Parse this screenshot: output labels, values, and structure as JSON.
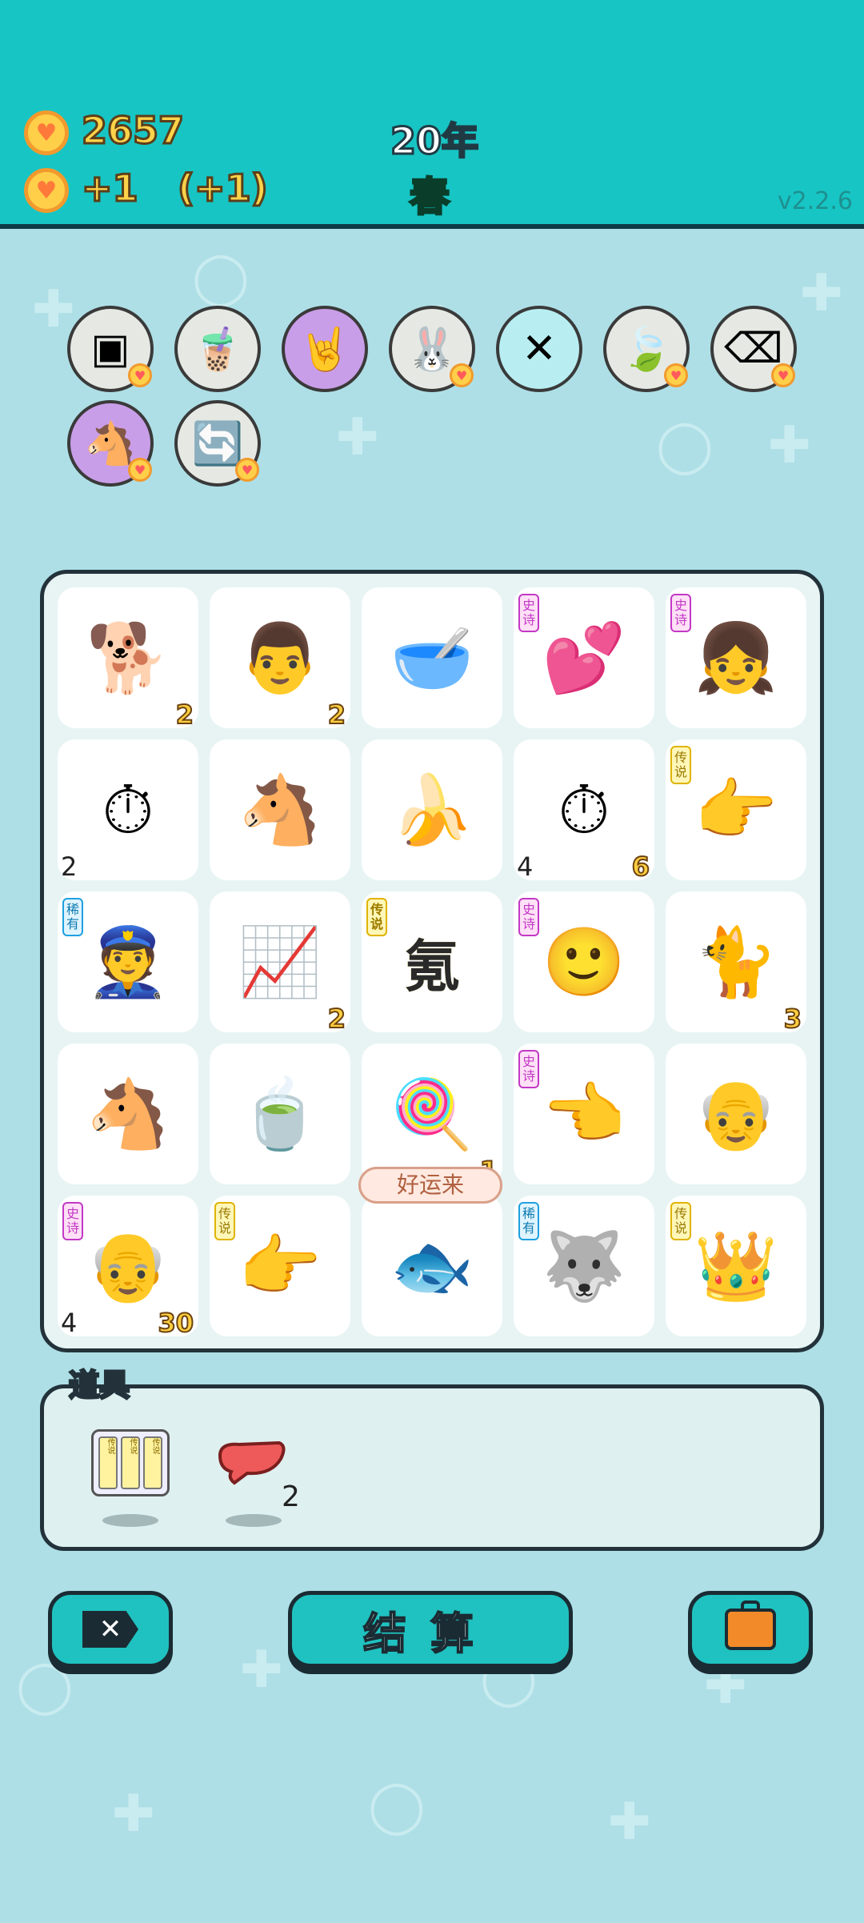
{
  "hud": {
    "coins": "2657",
    "income": "+1",
    "bonus": "(+1)",
    "year": "20年",
    "season": "春",
    "version": "v2.2.6"
  },
  "upgrades": [
    {
      "icon": "sugar-cubes-icon",
      "glyph": "▣",
      "bg": "#e6e9e3",
      "heart": true
    },
    {
      "icon": "bubble-tea-icon",
      "glyph": "🧋",
      "bg": "#e6e9e3",
      "heart": false
    },
    {
      "icon": "rock-hand-icon",
      "glyph": "🤘",
      "bg": "#c99ee8",
      "heart": false
    },
    {
      "icon": "bunny-icon",
      "glyph": "🐰",
      "bg": "#e6e9e3",
      "heart": true
    },
    {
      "icon": "chopsticks-icon",
      "glyph": "✕",
      "bg": "#b8eef2",
      "heart": false
    },
    {
      "icon": "leaf-icon",
      "glyph": "🍃",
      "bg": "#e6e9e3",
      "heart": true
    },
    {
      "icon": "delete-tag-icon",
      "glyph": "⌫",
      "bg": "#e6e9e3",
      "heart": true
    },
    {
      "icon": "twin-horses-icon",
      "glyph": "🐴",
      "bg": "#c99ee8",
      "heart": true
    },
    {
      "icon": "refresh-icon",
      "glyph": "🔄",
      "bg": "#e6e9e3",
      "heart": true
    }
  ],
  "board": [
    {
      "icon": "dog-icon",
      "glyph": "🐕",
      "badge": "",
      "count_r": "2",
      "count_l": ""
    },
    {
      "icon": "man-face-icon",
      "glyph": "👨",
      "badge": "",
      "count_r": "2",
      "count_l": ""
    },
    {
      "icon": "bowl-icon",
      "glyph": "🥣",
      "badge": "",
      "count_r": "",
      "count_l": ""
    },
    {
      "icon": "girl-hearts-icon",
      "glyph": "💕",
      "badge": "史诗",
      "badge_type": "epic",
      "count_r": "",
      "count_l": ""
    },
    {
      "icon": "girl-face-icon",
      "glyph": "👧",
      "badge": "史诗",
      "badge_type": "epic",
      "count_r": "",
      "count_l": ""
    },
    {
      "icon": "stopwatch-card-icon",
      "glyph": "⏱",
      "badge": "",
      "count_r": "",
      "count_l": "2"
    },
    {
      "icon": "horse-icon",
      "glyph": "🐴",
      "badge": "",
      "count_r": "",
      "count_l": ""
    },
    {
      "icon": "banana-icon",
      "glyph": "🍌",
      "badge": "",
      "count_r": "",
      "count_l": ""
    },
    {
      "icon": "stopwatch-card-icon",
      "glyph": "⏱",
      "badge": "",
      "count_r": "6",
      "count_l": "4"
    },
    {
      "icon": "yellow-hand-icon",
      "glyph": "👉",
      "badge": "传说",
      "badge_type": "legend",
      "count_r": "",
      "count_l": ""
    },
    {
      "icon": "police-icon",
      "glyph": "👮",
      "badge": "稀有",
      "badge_type": "rare",
      "count_r": "",
      "count_l": ""
    },
    {
      "icon": "chart-up-icon",
      "glyph": "📈",
      "badge": "",
      "count_r": "2",
      "count_l": ""
    },
    {
      "icon": "krypton-glyph-icon",
      "glyph": "氪",
      "badge": "传说",
      "badge_type": "legend",
      "count_r": "",
      "count_l": ""
    },
    {
      "icon": "yellow-face-icon",
      "glyph": "🙂",
      "badge": "史诗",
      "badge_type": "epic",
      "count_r": "",
      "count_l": ""
    },
    {
      "icon": "cat-icon",
      "glyph": "🐈",
      "badge": "",
      "count_r": "3",
      "count_l": ""
    },
    {
      "icon": "horse-icon",
      "glyph": "🐴",
      "badge": "",
      "count_r": "",
      "count_l": ""
    },
    {
      "icon": "tea-bag-icon",
      "glyph": "🍵",
      "badge": "",
      "count_r": "",
      "count_l": ""
    },
    {
      "icon": "lucky-lollipop-icon",
      "glyph": "🍭",
      "badge": "",
      "count_r": "1",
      "count_l": ""
    },
    {
      "icon": "gray-hand-icon",
      "glyph": "👈",
      "badge": "史诗",
      "badge_type": "epic",
      "count_r": "",
      "count_l": ""
    },
    {
      "icon": "old-man-icon",
      "glyph": "👴",
      "badge": "",
      "count_r": "",
      "count_l": ""
    },
    {
      "icon": "grandpa-glasses-icon",
      "glyph": "👴",
      "badge": "史诗",
      "badge_type": "epic",
      "count_r": "30",
      "count_l": "4"
    },
    {
      "icon": "yellow-hand-icon",
      "glyph": "👉",
      "badge": "传说",
      "badge_type": "legend",
      "count_r": "",
      "count_l": ""
    },
    {
      "icon": "koi-fish-icon",
      "glyph": "🐟",
      "badge": "",
      "count_r": "",
      "count_l": ""
    },
    {
      "icon": "husky-icon",
      "glyph": "🐺",
      "badge": "稀有",
      "badge_type": "rare",
      "count_r": "",
      "count_l": ""
    },
    {
      "icon": "crowned-husky-icon",
      "glyph": "👑",
      "badge": "传说",
      "badge_type": "legend",
      "count_r": "",
      "count_l": ""
    }
  ],
  "luck_label": "好运来",
  "items": {
    "title": "道具",
    "list": [
      {
        "icon": "legend-scrolls-icon",
        "label": "传说",
        "count": ""
      },
      {
        "icon": "liver-icon",
        "label": "",
        "count": "2"
      }
    ]
  },
  "buttons": {
    "exit": "exit-icon",
    "settle": "结算",
    "bag": "briefcase-icon"
  },
  "colors": {
    "topbar": "#17c5c4",
    "background": "#aedfe6",
    "button": "#1fc2c0"
  }
}
